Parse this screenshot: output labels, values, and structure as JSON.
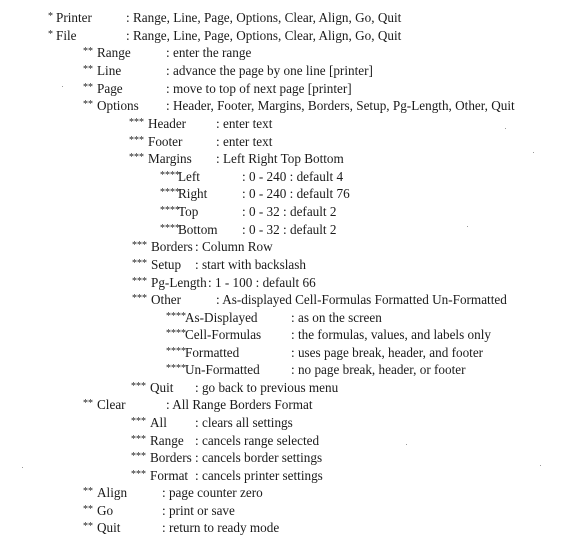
{
  "items": [
    {
      "level": 1,
      "key": "Printer",
      "value": ": Range, Line, Page, Options, Clear, Align, Go, Quit"
    },
    {
      "level": 1,
      "key": "File",
      "value": ": Range, Line, Page, Options, Clear, Align, Go, Quit"
    },
    {
      "level": 2,
      "key": "Range",
      "value": ": enter the range"
    },
    {
      "level": 2,
      "key": "Line",
      "value": ": advance the page by one line [printer]"
    },
    {
      "level": 2,
      "key": "Page",
      "value": ": move to top of next page [printer]"
    },
    {
      "level": 2,
      "key": "Options",
      "value": ": Header, Footer, Margins, Borders, Setup, Pg-Length, Other, Quit"
    },
    {
      "level": 3,
      "key": "Header",
      "value": ": enter text"
    },
    {
      "level": 3,
      "key": "Footer",
      "value": ": enter text"
    },
    {
      "level": 3,
      "key": "Margins",
      "value": ": Left Right Top Bottom"
    },
    {
      "level": 4,
      "group": "margins",
      "key": "Left",
      "value": ": 0 - 240 : default 4"
    },
    {
      "level": 4,
      "group": "margins",
      "key": "Right",
      "value": ": 0 - 240 : default 76"
    },
    {
      "level": 4,
      "group": "margins",
      "key": "Top",
      "value": ": 0 - 32  : default 2"
    },
    {
      "level": 4,
      "group": "margins",
      "key": "Bottom",
      "value": ": 0 - 32 : default 2"
    },
    {
      "level": 3,
      "key": "Borders",
      "value": ": Column Row"
    },
    {
      "level": 3,
      "key": "Setup",
      "value": ": start with backslash"
    },
    {
      "level": 3,
      "key": "Pg-Length",
      "value": ": 1 - 100 : default 66"
    },
    {
      "level": 3,
      "key": "Other",
      "value": ": As-displayed Cell-Formulas Formatted Un-Formatted"
    },
    {
      "level": 4,
      "group": "other",
      "key": "As-Displayed",
      "value": ": as on the screen"
    },
    {
      "level": 4,
      "group": "other",
      "key": "Cell-Formulas",
      "value": ": the formulas, values, and labels only"
    },
    {
      "level": 4,
      "group": "other",
      "key": "Formatted",
      "value": ": uses page break, header, and footer"
    },
    {
      "level": 4,
      "group": "other",
      "key": "Un-Formatted",
      "value": ": no page break, header, or footer"
    },
    {
      "level": 3,
      "key": "Quit",
      "value": ": go back to previous menu"
    },
    {
      "level": 2,
      "key": "Clear",
      "value": ": All Range Borders Format"
    },
    {
      "level": 3,
      "key": "All",
      "value": ": clears all settings"
    },
    {
      "level": 3,
      "key": "Range",
      "value": ": cancels range selected"
    },
    {
      "level": 3,
      "key": "Borders",
      "value": ": cancels border settings"
    },
    {
      "level": 3,
      "key": "Format",
      "value": ": cancels printer settings"
    },
    {
      "level": 2,
      "key": "Align",
      "value": ": page counter zero"
    },
    {
      "level": 2,
      "key": "Go",
      "value": ": print or save"
    },
    {
      "level": 2,
      "key": "Quit",
      "value": ": return to ready mode"
    }
  ]
}
